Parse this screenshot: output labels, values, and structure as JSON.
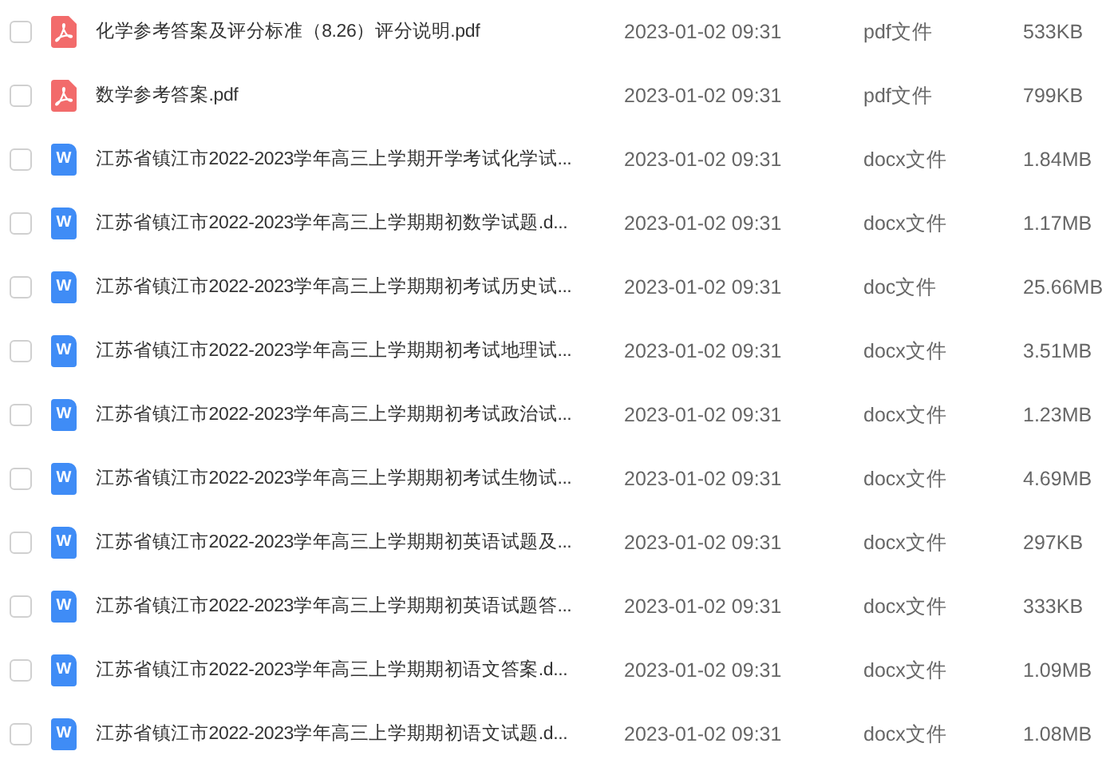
{
  "files": [
    {
      "name": "化学参考答案及评分标准（8.26）评分说明.pdf",
      "kind": "pdf",
      "date": "2023-01-02 09:31",
      "type": "pdf文件",
      "size": "533KB",
      "checked": false
    },
    {
      "name": "数学参考答案.pdf",
      "kind": "pdf",
      "date": "2023-01-02 09:31",
      "type": "pdf文件",
      "size": "799KB",
      "checked": false
    },
    {
      "name": "江苏省镇江市2022-2023学年高三上学期开学考试化学试...",
      "kind": "word",
      "icon_letter": "W",
      "date": "2023-01-02 09:31",
      "type": "docx文件",
      "size": "1.84MB",
      "checked": false
    },
    {
      "name": "江苏省镇江市2022-2023学年高三上学期期初数学试题.d...",
      "kind": "word",
      "icon_letter": "W",
      "date": "2023-01-02 09:31",
      "type": "docx文件",
      "size": "1.17MB",
      "checked": false
    },
    {
      "name": "江苏省镇江市2022-2023学年高三上学期期初考试历史试...",
      "kind": "word",
      "icon_letter": "W",
      "date": "2023-01-02 09:31",
      "type": "doc文件",
      "size": "25.66MB",
      "checked": false
    },
    {
      "name": "江苏省镇江市2022-2023学年高三上学期期初考试地理试...",
      "kind": "word",
      "icon_letter": "W",
      "date": "2023-01-02 09:31",
      "type": "docx文件",
      "size": "3.51MB",
      "checked": false
    },
    {
      "name": "江苏省镇江市2022-2023学年高三上学期期初考试政治试...",
      "kind": "word",
      "icon_letter": "W",
      "date": "2023-01-02 09:31",
      "type": "docx文件",
      "size": "1.23MB",
      "checked": false
    },
    {
      "name": "江苏省镇江市2022-2023学年高三上学期期初考试生物试...",
      "kind": "word",
      "icon_letter": "W",
      "date": "2023-01-02 09:31",
      "type": "docx文件",
      "size": "4.69MB",
      "checked": false
    },
    {
      "name": "江苏省镇江市2022-2023学年高三上学期期初英语试题及...",
      "kind": "word",
      "icon_letter": "W",
      "date": "2023-01-02 09:31",
      "type": "docx文件",
      "size": "297KB",
      "checked": false
    },
    {
      "name": "江苏省镇江市2022-2023学年高三上学期期初英语试题答...",
      "kind": "word",
      "icon_letter": "W",
      "date": "2023-01-02 09:31",
      "type": "docx文件",
      "size": "333KB",
      "checked": false
    },
    {
      "name": "江苏省镇江市2022-2023学年高三上学期期初语文答案.d...",
      "kind": "word",
      "icon_letter": "W",
      "date": "2023-01-02 09:31",
      "type": "docx文件",
      "size": "1.09MB",
      "checked": false
    },
    {
      "name": "江苏省镇江市2022-2023学年高三上学期期初语文试题.d...",
      "kind": "word",
      "icon_letter": "W",
      "date": "2023-01-02 09:31",
      "type": "docx文件",
      "size": "1.08MB",
      "checked": false
    }
  ]
}
